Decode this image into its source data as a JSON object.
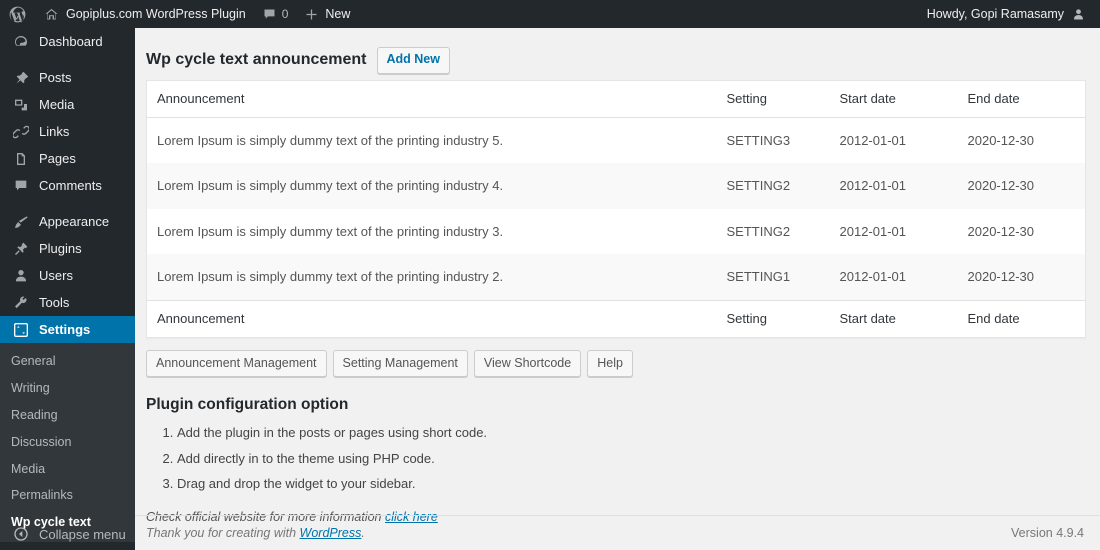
{
  "adminbar": {
    "logo_icon": "wordpress-logo-icon",
    "site_home_icon": "home-icon",
    "site_name": "Gopiplus.com WordPress Plugin",
    "comments_icon": "comment-bubble-icon",
    "comments_count": "0",
    "new_icon": "plus-icon",
    "new_label": "New",
    "howdy": "Howdy, Gopi Ramasamy",
    "avatar_icon": "user-avatar-icon"
  },
  "sidebar": {
    "items": [
      {
        "label": "Dashboard",
        "icon": "dashboard-icon"
      },
      {
        "label": "Posts",
        "icon": "pin-icon"
      },
      {
        "label": "Media",
        "icon": "media-icon"
      },
      {
        "label": "Links",
        "icon": "link-icon"
      },
      {
        "label": "Pages",
        "icon": "pages-icon"
      },
      {
        "label": "Comments",
        "icon": "comment-bubble-icon"
      },
      {
        "label": "Appearance",
        "icon": "paintbrush-icon"
      },
      {
        "label": "Plugins",
        "icon": "plug-icon"
      },
      {
        "label": "Users",
        "icon": "user-icon"
      },
      {
        "label": "Tools",
        "icon": "wrench-icon"
      },
      {
        "label": "Settings",
        "icon": "settings-sliders-icon"
      }
    ],
    "submenu": [
      {
        "label": "General"
      },
      {
        "label": "Writing"
      },
      {
        "label": "Reading"
      },
      {
        "label": "Discussion"
      },
      {
        "label": "Media"
      },
      {
        "label": "Permalinks"
      },
      {
        "label": "Wp cycle text"
      }
    ],
    "collapse": {
      "label": "Collapse menu",
      "icon": "collapse-arrow-icon"
    },
    "accent_color": "#0073aa",
    "background_color": "#23282d",
    "submenu_background_color": "#32373c"
  },
  "page": {
    "title": "Wp cycle text announcement",
    "add_new_label": "Add New"
  },
  "table": {
    "columns": [
      "Announcement",
      "Setting",
      "Start date",
      "End date"
    ],
    "rows": [
      {
        "announcement": "Lorem Ipsum is simply dummy text of the printing industry 5.",
        "setting": "SETTING3",
        "start_date": "2012-01-01",
        "end_date": "2020-12-30"
      },
      {
        "announcement": "Lorem Ipsum is simply dummy text of the printing industry 4.",
        "setting": "SETTING2",
        "start_date": "2012-01-01",
        "end_date": "2020-12-30"
      },
      {
        "announcement": "Lorem Ipsum is simply dummy text of the printing industry 3.",
        "setting": "SETTING2",
        "start_date": "2012-01-01",
        "end_date": "2020-12-30"
      },
      {
        "announcement": "Lorem Ipsum is simply dummy text of the printing industry 2.",
        "setting": "SETTING1",
        "start_date": "2012-01-01",
        "end_date": "2020-12-30"
      }
    ]
  },
  "buttons": [
    {
      "label": "Announcement Management"
    },
    {
      "label": "Setting Management"
    },
    {
      "label": "View Shortcode"
    },
    {
      "label": "Help"
    }
  ],
  "config": {
    "title": "Plugin configuration option",
    "steps": [
      "Add the plugin in the posts or pages using short code.",
      "Add directly in to the theme using PHP code.",
      "Drag and drop the widget to your sidebar."
    ],
    "note_text": "Check official website for more information",
    "note_link": "click here"
  },
  "footer": {
    "thanks_prefix": "Thank you for creating with ",
    "thanks_link": "WordPress",
    "thanks_suffix": ".",
    "version": "Version 4.9.4"
  }
}
